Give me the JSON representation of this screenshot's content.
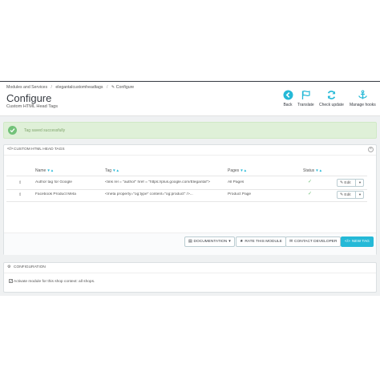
{
  "breadcrumb": {
    "items": [
      "Modules and Services",
      "elegantalcustomheadtags",
      "Configure"
    ]
  },
  "header": {
    "title": "Configure",
    "subtitle": "Custom HTML Head Tags"
  },
  "toolbar": {
    "back": "Back",
    "translate": "Translate",
    "check_update": "Check update",
    "manage_hooks": "Manage hooks"
  },
  "alert": {
    "text": "Tag saved successfully"
  },
  "tags_panel": {
    "heading": "CUSTOM HTML HEAD TAGS",
    "columns": {
      "name": "Name",
      "tag": "Tag",
      "pages": "Pages",
      "status": "Status"
    },
    "sort_glyph": "▼▲",
    "rows": [
      {
        "name": "Author tag for Google",
        "tag": "<link rel = \"author\" href = \"https://plus.google.com/Elegantal\">",
        "pages": "All Pages",
        "status": "✓",
        "action": "Edit"
      },
      {
        "name": "Facebook Product Meta",
        "tag": "<meta property=\"og:type\" content=\"og:product\" />...",
        "pages": "Product Page",
        "status": "✓",
        "action": "Edit"
      }
    ],
    "buttons": {
      "documentation": "DOCUMENTATION",
      "rate": "RATE THIS MODULE",
      "contact": "CONTACT DEVELOPER",
      "new_tag": "NEW TAG"
    }
  },
  "config_panel": {
    "heading": "CONFIGURATION",
    "checkbox_label": "Activate module for this shop context: all shops."
  },
  "colors": {
    "accent": "#25b9d7",
    "success": "#72c279",
    "alert_bg": "#dff0d8"
  },
  "icons": {
    "back": "back-arrow-circle-icon",
    "translate": "flag-icon",
    "check_update": "refresh-icon",
    "manage_hooks": "anchor-icon"
  }
}
